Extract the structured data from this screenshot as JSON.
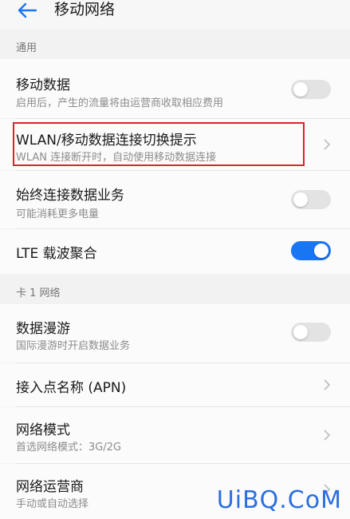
{
  "header": {
    "title": "移动网络"
  },
  "sections": {
    "general": {
      "label": "通用"
    },
    "card1": {
      "label": "卡 1 网络"
    }
  },
  "rows": {
    "mobile_data": {
      "title": "移动数据",
      "subtitle": "启用后，产生的流量将由运营商收取相应费用",
      "toggle": "off"
    },
    "wlan_switch": {
      "title": "WLAN/移动数据连接切换提示",
      "subtitle": "WLAN 连接断开时，自动使用移动数据连接"
    },
    "always_connected": {
      "title": "始终连接数据业务",
      "subtitle": "可能消耗更多电量",
      "toggle": "off"
    },
    "lte_ca": {
      "title": "LTE 载波聚合",
      "toggle": "on"
    },
    "roaming": {
      "title": "数据漫游",
      "subtitle": "国际漫游时开启数据业务",
      "toggle": "off"
    },
    "apn": {
      "title": "接入点名称 (APN)"
    },
    "network_mode": {
      "title": "网络模式",
      "subtitle": "首选网络模式：3G/2G"
    },
    "operator": {
      "title": "网络运营商",
      "subtitle": "手动或自动选择"
    }
  },
  "watermark": "UiBQ.CoM",
  "colors": {
    "accent": "#1976f2",
    "highlight": "#e1202c",
    "toggle_off": "#e3e3e3"
  }
}
